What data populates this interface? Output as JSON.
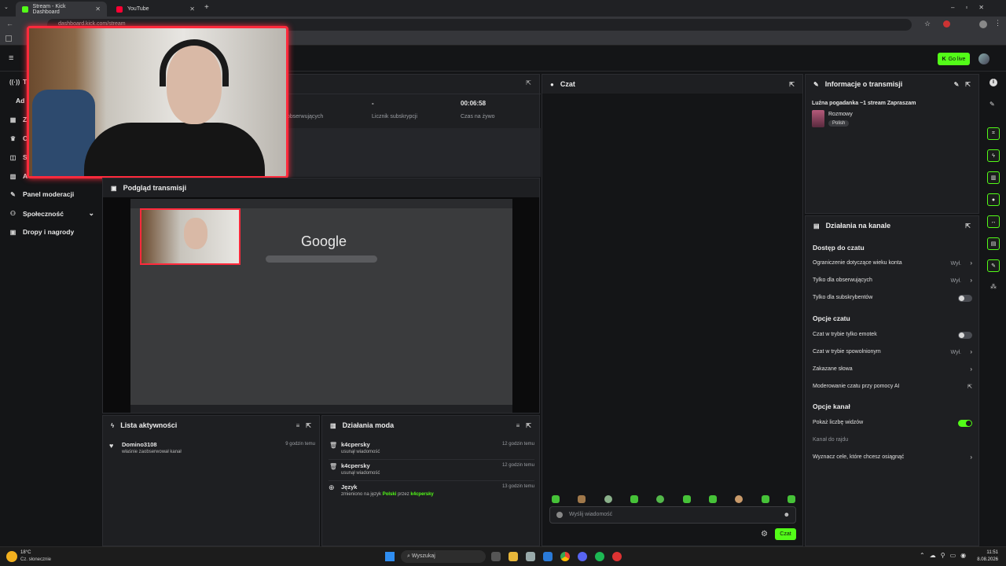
{
  "browser": {
    "tabs": [
      {
        "title": "Stream - Kick Dashboard",
        "active": true
      },
      {
        "title": "YouTube",
        "active": false
      }
    ],
    "url": "dashboard.kick.com/stream"
  },
  "topbar": {
    "go_live": "Go live"
  },
  "sidebar": {
    "items": [
      {
        "label": "Panel moderacji",
        "icon": "wrench-icon"
      },
      {
        "label": "Społeczność",
        "icon": "community-icon"
      },
      {
        "label": "Dropy i nagrody",
        "icon": "gift-icon"
      }
    ],
    "partial": [
      "T",
      "Ad",
      "Z",
      "O",
      "Sł",
      "A"
    ]
  },
  "stats": {
    "followers_label": "obserwujących",
    "subs_value": "-",
    "subs_label": "Licznik subskrypcji",
    "time_value": "00:06:58",
    "time_label": "Czas na żywo"
  },
  "preview": {
    "title": "Podgląd transmisji",
    "google": "Google"
  },
  "activity": {
    "title": "Lista aktywności",
    "items": [
      {
        "user": "Domino3108",
        "text": "właśnie zaobserwował kanał",
        "time": "9 godzin temu"
      }
    ]
  },
  "mod_actions": {
    "title": "Działania moda",
    "items": [
      {
        "user": "k4cpersky",
        "text": "usunął wiadomość",
        "time": "12 godzin temu"
      },
      {
        "user": "k4cpersky",
        "text": "usunął wiadomość",
        "time": "12 godzin temu"
      },
      {
        "user": "Język",
        "text_pre": "zmieniono na język",
        "lang": "Polski",
        "by": "przez",
        "mod": "k4cpersky",
        "time": "13 godzin temu"
      }
    ]
  },
  "chat": {
    "title": "Czat",
    "placeholder": "Wyślij wiadomość",
    "send": "Czat"
  },
  "stream_info": {
    "title": "Informacje o transmisji",
    "stream_title": "Luźna pogadanka ~1 stream Zapraszam",
    "category": "Rozmowy",
    "tag": "Polish"
  },
  "channel_actions": {
    "title": "Działania na kanale",
    "chat_access": "Dostęp do czatu",
    "age_limit": "Ograniczenie dotyczące wieku konta",
    "age_limit_val": "Wył.",
    "followers_only": "Tylko dla obserwujących",
    "followers_only_val": "Wył.",
    "subs_only": "Tylko dla subskrybentów",
    "chat_options": "Opcje czatu",
    "emote_only": "Czat w trybie tylko emotek",
    "slow_mode": "Czat w trybie spowolnionym",
    "slow_mode_val": "Wył.",
    "banned_words": "Zakazane słowa",
    "ai_moderation": "Moderowanie czatu przy pomocy AI",
    "channel_options": "Opcje kanał",
    "show_viewers": "Pokaż liczbę widzów",
    "raid_channel": "Kanał do rajdu",
    "set_goals": "Wyznacz cele, które chcesz osiągnąć"
  },
  "taskbar": {
    "temp": "18°C",
    "weather": "Cz. słonecznie",
    "search": "Wyszukaj",
    "time": "11:51",
    "date": "8.08.2026"
  },
  "colors": {
    "accent": "#53fc18",
    "webcam_border": "#ff2a3c"
  }
}
